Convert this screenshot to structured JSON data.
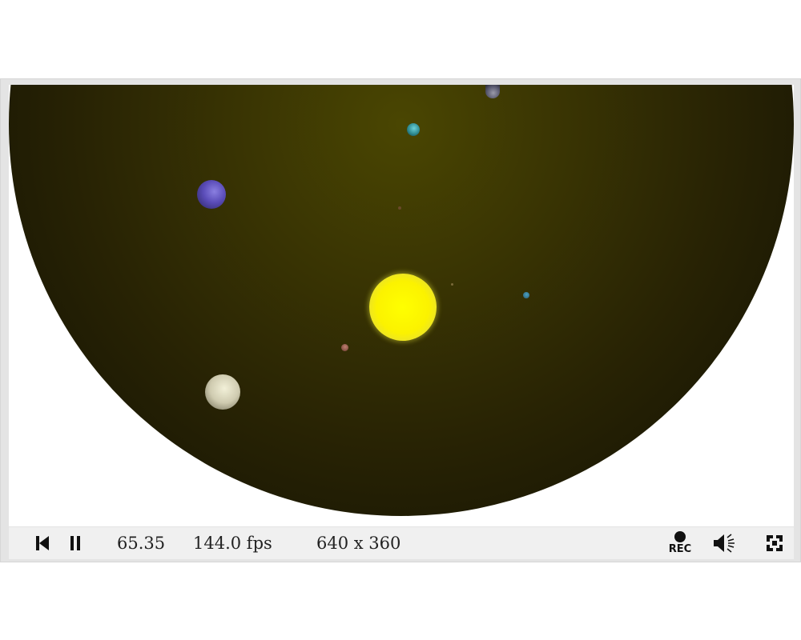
{
  "status": {
    "time": "65.35",
    "fps": "144.0 fps",
    "resolution": "640 x 360"
  },
  "controls": {
    "rec_label": "REC"
  },
  "icons": {
    "rewind": "skip-to-start-icon",
    "pause": "pause-icon",
    "record": "record-icon",
    "volume": "volume-icon",
    "fullscreen": "fullscreen-icon"
  },
  "colors": {
    "sun": "#ffff00",
    "space": "#3a3503",
    "toolbar": "#f0f0f0"
  }
}
